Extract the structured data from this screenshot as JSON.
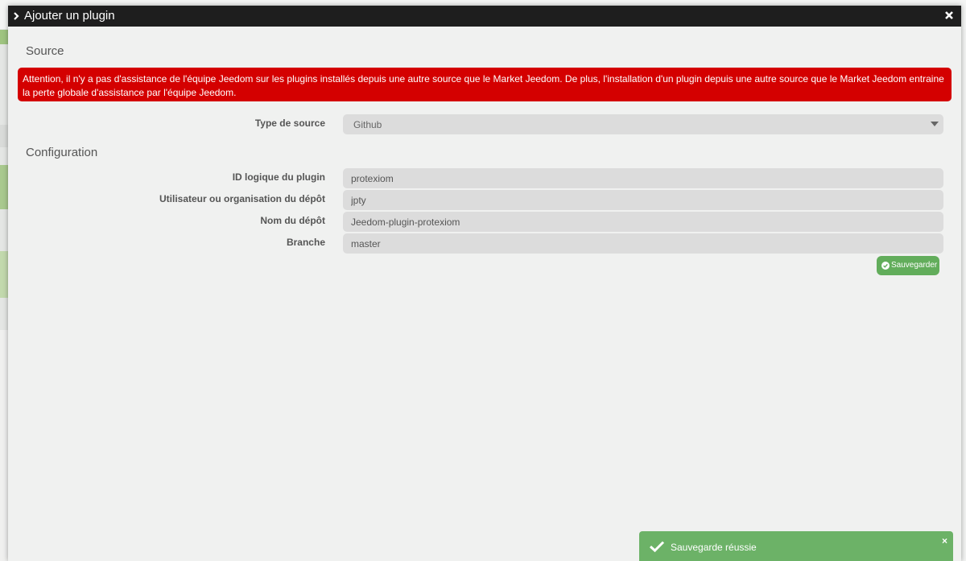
{
  "modal": {
    "title": "Ajouter un plugin"
  },
  "source": {
    "heading": "Source",
    "warning": "Attention, il n'y a pas d'assistance de l'équipe Jeedom sur les plugins installés depuis une autre source que le Market Jeedom. De plus, l'installation d'un plugin depuis une autre source que le Market Jeedom entraine la perte globale d'assistance par l'équipe Jeedom.",
    "type_label": "Type de source",
    "type_value": "Github"
  },
  "configuration": {
    "heading": "Configuration",
    "fields": [
      {
        "label": "ID logique du plugin",
        "value": "protexiom"
      },
      {
        "label": "Utilisateur ou organisation du dépôt",
        "value": "jpty"
      },
      {
        "label": "Nom du dépôt",
        "value": "Jeedom-plugin-protexiom"
      },
      {
        "label": "Branche",
        "value": "master"
      }
    ],
    "save_label": "Sauvegarder"
  },
  "toast": {
    "message": "Sauvegarde réussie",
    "close": "×"
  },
  "colors": {
    "alert": "#d40000",
    "success": "#62ad5b",
    "titlebar": "#1e1e1e"
  }
}
